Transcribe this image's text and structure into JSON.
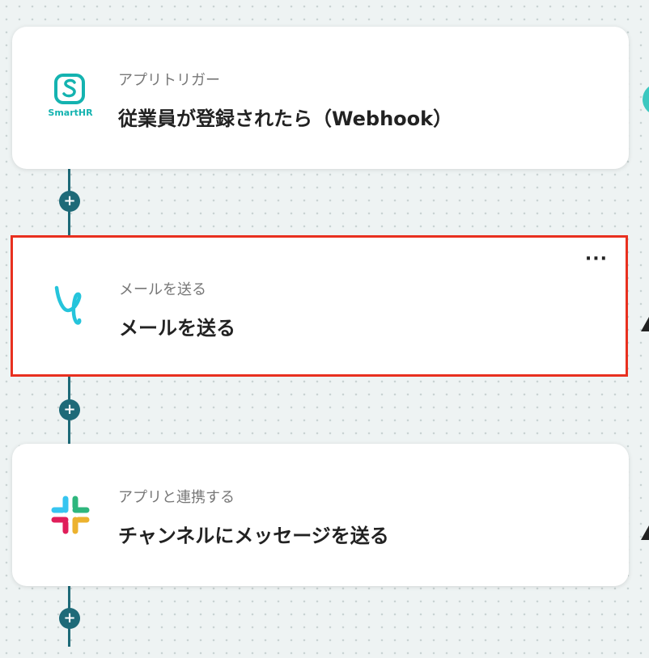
{
  "steps": [
    {
      "category": "アプリトリガー",
      "title": "従業員が登録されたら（Webhook）",
      "app": "SmartHR",
      "icon": "smarthr-icon",
      "color": "#14b3b0"
    },
    {
      "category": "メールを送る",
      "title": "メールを送る",
      "icon": "mail-app-icon",
      "color": "#25c4db",
      "more": "···"
    },
    {
      "category": "アプリと連携する",
      "title": "チャンネルにメッセージを送る",
      "icon": "slack-icon"
    }
  ],
  "add_symbol": "+",
  "colors": {
    "flow_line": "#1e6a78",
    "selected_border": "#e8301f"
  }
}
